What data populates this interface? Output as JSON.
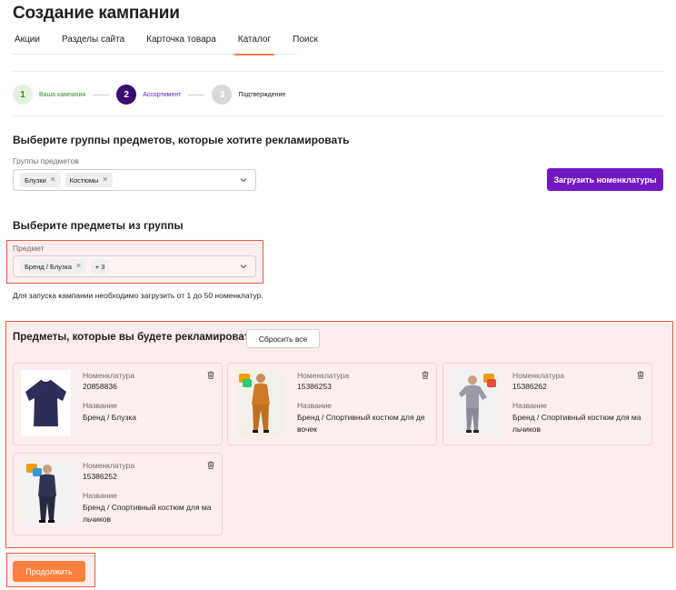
{
  "page": {
    "title": "Создание кампании"
  },
  "tabs": [
    {
      "label": "Акции"
    },
    {
      "label": "Разделы сайта"
    },
    {
      "label": "Карточка товара"
    },
    {
      "label": "Каталог",
      "active": true
    },
    {
      "label": "Поиск"
    }
  ],
  "stepper": {
    "steps": [
      {
        "number": "1",
        "label": "Ваша кампания",
        "state": "done"
      },
      {
        "number": "2",
        "label": "Ассортимент",
        "state": "current"
      },
      {
        "number": "3",
        "label": "Подтверждение",
        "state": "todo"
      }
    ]
  },
  "groups": {
    "heading": "Выберите группы предметов, которые хотите рекламировать",
    "field_label": "Группы предметов",
    "chips": [
      "Блузки",
      "Костюмы"
    ],
    "upload_button": "Загрузить номенклатуры"
  },
  "subject": {
    "heading": "Выберите предметы из группы",
    "field_label": "Предмет",
    "chip": "Бренд / Блузка",
    "more": "+ 3",
    "note": "Для запуска кампании необходимо загрузить от 1 до 50 номенклатур."
  },
  "items": {
    "heading": "Предметы, которые вы будете рекламировать",
    "count": "4",
    "reset_button": "Сбросить все",
    "nomenclature_label": "Номенклатура",
    "name_label": "Название",
    "cards": [
      {
        "nomenclature": "20858836",
        "name": "Бренд / Блузка",
        "image": "blouse-photo"
      },
      {
        "nomenclature": "15386253",
        "name": "Бренд / Спортивный костюм для девочек",
        "image": "girl-orange-tracksuit-photo"
      },
      {
        "nomenclature": "15386262",
        "name": "Бренд / Спортивный костюм для мальчиков",
        "image": "boy-grey-tracksuit-photo"
      },
      {
        "nomenclature": "15386252",
        "name": "Бренд / Спортивный костюм для мальчиков",
        "image": "boy-navy-tracksuit-photo"
      }
    ]
  },
  "footer": {
    "continue_button": "Продолжить"
  },
  "colors": {
    "accent_purple": "#7117c4",
    "step_current": "#3d0a71",
    "step_done_bg": "#e2f3dc",
    "step_done_text": "#3a8a2c",
    "tab_underline": "#ff7a45",
    "continue_button": "#ff7f3f",
    "highlight_border": "#ee5b3c",
    "highlight_fill": "#fdecec"
  }
}
